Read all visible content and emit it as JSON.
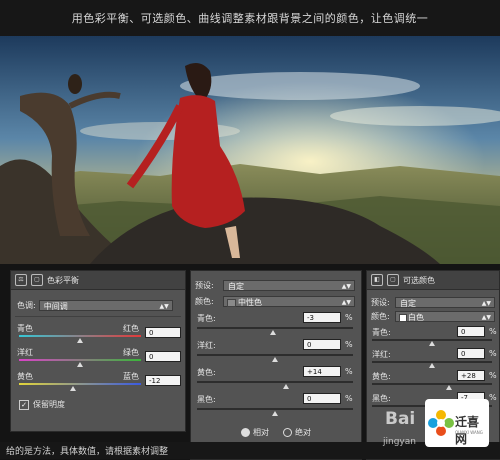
{
  "header": {
    "caption": "用色彩平衡、可选颜色、曲线调整素材跟背景之间的颜色，让色调统一"
  },
  "color_balance": {
    "title": "色彩平衡",
    "tone_label": "色调:",
    "tone_value": "中间调",
    "sliders": [
      {
        "left": "青色",
        "right": "红色",
        "value": "0",
        "level": 0,
        "colors": [
          "#36c7d6",
          "#e23a3a"
        ]
      },
      {
        "left": "洋红",
        "right": "绿色",
        "value": "0",
        "level": 0,
        "colors": [
          "#d943c7",
          "#3ab53a"
        ]
      },
      {
        "left": "黄色",
        "right": "蓝色",
        "value": "-12",
        "level": -12,
        "colors": [
          "#e2d53a",
          "#3a5ae2"
        ]
      }
    ],
    "preserve_label": "保留明度"
  },
  "selective_color_main": {
    "preset_label": "预设:",
    "preset_value": "自定",
    "colors_label": "颜色:",
    "colors_value": "中性色",
    "sliders": [
      {
        "label": "青色:",
        "value": "-3",
        "level": -3
      },
      {
        "label": "洋红:",
        "value": "0",
        "level": 0
      },
      {
        "label": "黄色:",
        "value": "+14",
        "level": 14
      },
      {
        "label": "黑色:",
        "value": "0",
        "level": 0
      }
    ],
    "pct": "%",
    "radio_relative": "相对",
    "radio_absolute": "绝对"
  },
  "selective_color_small": {
    "title": "可选颜色",
    "preset_label": "预设:",
    "preset_value": "自定",
    "colors_label": "颜色:",
    "colors_value": "白色",
    "sliders": [
      {
        "label": "青色:",
        "value": "0",
        "level": 0
      },
      {
        "label": "洋红:",
        "value": "0",
        "level": 0
      },
      {
        "label": "黄色:",
        "value": "+28",
        "level": 28
      },
      {
        "label": "黑色:",
        "value": "-7",
        "level": -7
      }
    ],
    "pct": "%"
  },
  "footer": {
    "text": "给的是方法，具体数值，请根据素材调整"
  },
  "watermark": {
    "text1": "Bai",
    "text2": "jingyan",
    "logo_text": "迁喜网",
    "logo_sub": "QIANXI WANG"
  }
}
